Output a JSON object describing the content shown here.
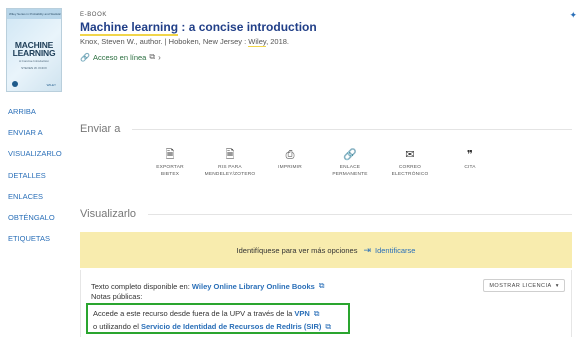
{
  "record": {
    "type_label": "E-BOOK",
    "title_highlight": "Machine learning",
    "title_rest": " : a concise introduction",
    "meta_before": "Knox, Steven W., author. | Hoboken, New Jersey : ",
    "meta_publisher": "Wiley",
    "meta_after": ", 2018.",
    "access_label": "Acceso en línea",
    "cover": {
      "strip": "Wiley Series in Probability and Statistics",
      "title_line1": "MACHINE",
      "title_line2": "LEARNING",
      "subtitle": "A Concise Introduction",
      "author": "STEVEN W. KNOX",
      "publisher": "WILEY"
    }
  },
  "nav": {
    "items": [
      "ARRIBA",
      "ENVIAR A",
      "VISUALIZARLO",
      "DETALLES",
      "ENLACES",
      "OBTÉNGALO",
      "ETIQUETAS"
    ]
  },
  "send_to": {
    "heading": "Enviar a",
    "items": [
      {
        "icon": "export-bibtex-icon",
        "glyph": "🗎",
        "line1": "EXPORTAR",
        "line2": "BIBTEX"
      },
      {
        "icon": "ris-icon",
        "glyph": "🗎",
        "line1": "RIS PARA",
        "line2": "MENDELEY/ZOTERO"
      },
      {
        "icon": "print-icon",
        "glyph": "⎙",
        "line1": "IMPRIMIR",
        "line2": ""
      },
      {
        "icon": "permalink-icon",
        "glyph": "🔗",
        "line1": "ENLACE",
        "line2": "PERMANENTE"
      },
      {
        "icon": "email-icon",
        "glyph": "✉",
        "line1": "CORREO",
        "line2": "ELECTRÓNICO"
      },
      {
        "icon": "quote-icon",
        "glyph": "❞",
        "line1": "CITA",
        "line2": ""
      }
    ]
  },
  "view_it": {
    "heading": "Visualizarlo",
    "signin_message": "Identifíquese para ver más opciones",
    "signin_button": "Identificarse",
    "fulltext_prefix": "Texto completo disponible en: ",
    "fulltext_link": "Wiley Online Library Online Books",
    "notes_label": "Notas públicas:",
    "license_button": "MOSTRAR LICENCIA",
    "note_line1_prefix": "Accede a este recurso desde fuera de la UPV a través de la ",
    "note_line1_link": "VPN",
    "note_line2_prefix": "o utilizando el ",
    "note_line2_link": "Servicio de Identidad de Recursos de RedIris (SIR)"
  },
  "colors": {
    "link": "#2a6fb8",
    "title": "#213f88",
    "highlight": "#f1d54a",
    "signin_bar": "#f8ecae",
    "box_border": "#2aa52f"
  }
}
